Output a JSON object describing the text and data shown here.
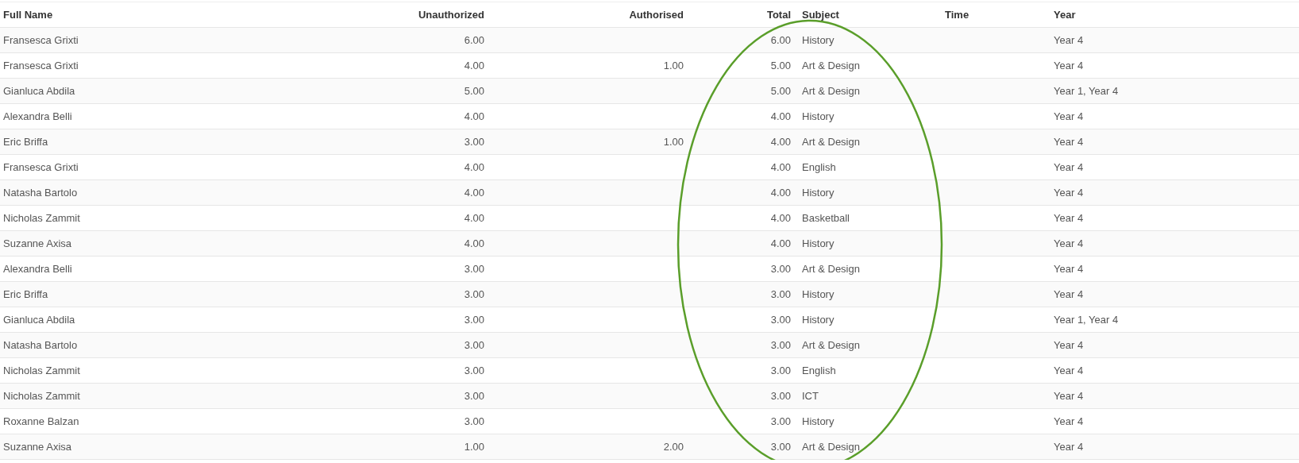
{
  "table": {
    "columns": [
      {
        "label": "Full Name",
        "kind": "text"
      },
      {
        "label": "Unauthorized",
        "kind": "number"
      },
      {
        "label": "Authorised",
        "kind": "number"
      },
      {
        "label": "Total",
        "kind": "number"
      },
      {
        "label": "Subject",
        "kind": "text"
      },
      {
        "label": "Time",
        "kind": "text"
      },
      {
        "label": "Year",
        "kind": "text"
      }
    ],
    "rows": [
      [
        "Fransesca Grixti",
        "6.00",
        "",
        "6.00",
        "History",
        "",
        "Year 4"
      ],
      [
        "Fransesca Grixti",
        "4.00",
        "1.00",
        "5.00",
        "Art & Design",
        "",
        "Year 4"
      ],
      [
        "Gianluca Abdila",
        "5.00",
        "",
        "5.00",
        "Art & Design",
        "",
        "Year 1, Year 4"
      ],
      [
        "Alexandra Belli",
        "4.00",
        "",
        "4.00",
        "History",
        "",
        "Year 4"
      ],
      [
        "Eric Briffa",
        "3.00",
        "1.00",
        "4.00",
        "Art & Design",
        "",
        "Year 4"
      ],
      [
        "Fransesca Grixti",
        "4.00",
        "",
        "4.00",
        "English",
        "",
        "Year 4"
      ],
      [
        "Natasha Bartolo",
        "4.00",
        "",
        "4.00",
        "History",
        "",
        "Year 4"
      ],
      [
        "Nicholas Zammit",
        "4.00",
        "",
        "4.00",
        "Basketball",
        "",
        "Year 4"
      ],
      [
        "Suzanne Axisa",
        "4.00",
        "",
        "4.00",
        "History",
        "",
        "Year 4"
      ],
      [
        "Alexandra Belli",
        "3.00",
        "",
        "3.00",
        "Art & Design",
        "",
        "Year 4"
      ],
      [
        "Eric Briffa",
        "3.00",
        "",
        "3.00",
        "History",
        "",
        "Year 4"
      ],
      [
        "Gianluca Abdila",
        "3.00",
        "",
        "3.00",
        "History",
        "",
        "Year 1, Year 4"
      ],
      [
        "Natasha Bartolo",
        "3.00",
        "",
        "3.00",
        "Art & Design",
        "",
        "Year 4"
      ],
      [
        "Nicholas Zammit",
        "3.00",
        "",
        "3.00",
        "English",
        "",
        "Year 4"
      ],
      [
        "Nicholas Zammit",
        "3.00",
        "",
        "3.00",
        "ICT",
        "",
        "Year 4"
      ],
      [
        "Roxanne Balzan",
        "3.00",
        "",
        "3.00",
        "History",
        "",
        "Year 4"
      ],
      [
        "Suzanne Axisa",
        "1.00",
        "2.00",
        "3.00",
        "Art & Design",
        "",
        "Year 4"
      ]
    ]
  },
  "annotation": {
    "kind": "ellipse",
    "color": "#5a9e2a"
  }
}
